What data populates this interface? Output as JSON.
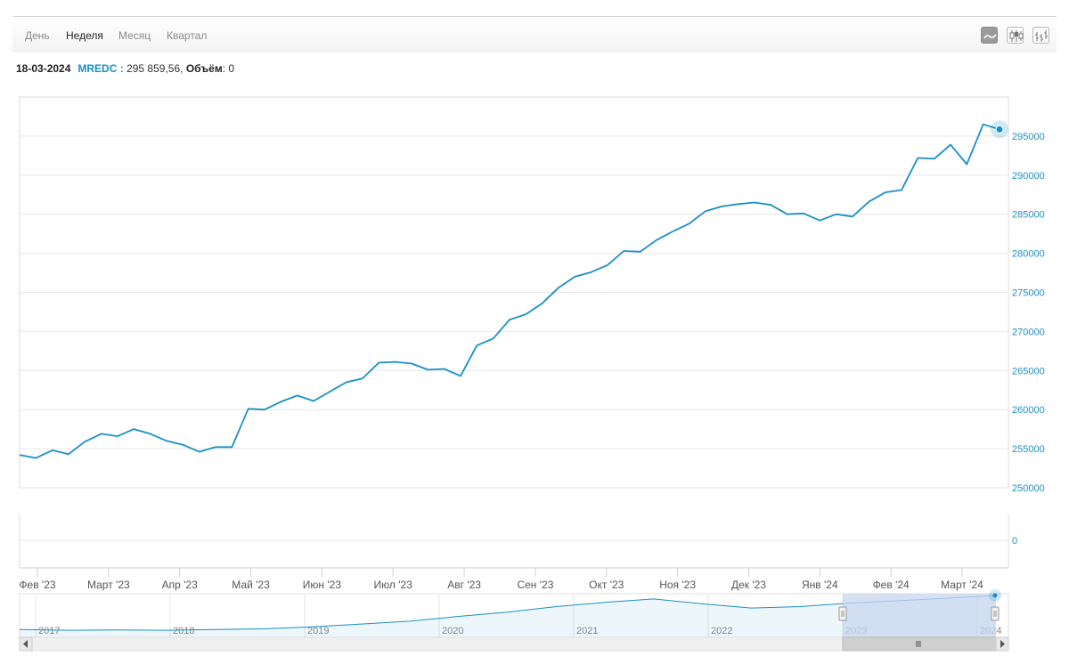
{
  "tabs": [
    {
      "label": "День",
      "active": false
    },
    {
      "label": "Неделя",
      "active": true
    },
    {
      "label": "Месяц",
      "active": false
    },
    {
      "label": "Квартал",
      "active": false
    }
  ],
  "chart_type_buttons": [
    {
      "icon": "line-chart-icon",
      "active": true
    },
    {
      "icon": "candlestick-icon",
      "active": false
    },
    {
      "icon": "ohlc-bars-icon",
      "active": false
    }
  ],
  "info": {
    "date": "18-03-2024",
    "symbol": "MREDC",
    "sep": " : ",
    "value": "295 859,56,",
    "volume_label": "Объём",
    "volume_value": ": 0"
  },
  "colors": {
    "line": "#1a8fc7",
    "grid": "#e6e6e6",
    "navigator_fill": "#c8d5ee",
    "axis_text": "#1a8fc7"
  },
  "chart_data": [
    {
      "type": "line",
      "ylim": [
        250000,
        300000
      ],
      "yticks": [
        "250000",
        "255000",
        "260000",
        "265000",
        "270000",
        "275000",
        "280000",
        "285000",
        "290000",
        "295000"
      ],
      "x_ticks": [
        "Фев '23",
        "Март '23",
        "Апр '23",
        "Май '23",
        "Июн '23",
        "Июл '23",
        "Авг '23",
        "Сен '23",
        "Окт '23",
        "Ноя '23",
        "Дек '23",
        "Янв '24",
        "Фев '24",
        "Март '24"
      ],
      "series": [
        {
          "values": [
            254200,
            253800,
            254800,
            254300,
            255900,
            256900,
            256600,
            257500,
            256900,
            256000,
            255500,
            254600,
            255200,
            255200,
            260100,
            260000,
            261000,
            261800,
            261100,
            262300,
            263500,
            264000,
            266000,
            266100,
            265900,
            265100,
            265200,
            264300,
            268200,
            269100,
            271500,
            272200,
            273600,
            275600,
            277000,
            277600,
            278500,
            280300,
            280200,
            281700,
            282800,
            283800,
            285400,
            286000,
            286300,
            286500,
            286200,
            285000,
            285100,
            284200,
            285000,
            284700,
            286600,
            287800,
            288100,
            292200,
            292100,
            293900,
            291400,
            296500,
            295860
          ]
        }
      ],
      "last_point": {
        "date": "18-03-2024",
        "value": 295859.56
      }
    },
    {
      "type": "bar",
      "title": "",
      "yticks": [
        "0"
      ],
      "series": [
        {
          "values": [
            0
          ]
        }
      ]
    },
    {
      "type": "area",
      "x_ticks": [
        "2017",
        "2018",
        "2019",
        "2020",
        "2021",
        "2022",
        "2023",
        "2024"
      ],
      "series": [
        {
          "values": [
            0.12,
            0.1,
            0.11,
            0.1,
            0.12,
            0.14,
            0.2,
            0.28,
            0.36,
            0.5,
            0.62,
            0.78,
            0.9,
            1.0,
            0.86,
            0.74,
            0.78,
            0.88,
            0.95,
            1.02,
            1.1
          ]
        }
      ]
    }
  ]
}
